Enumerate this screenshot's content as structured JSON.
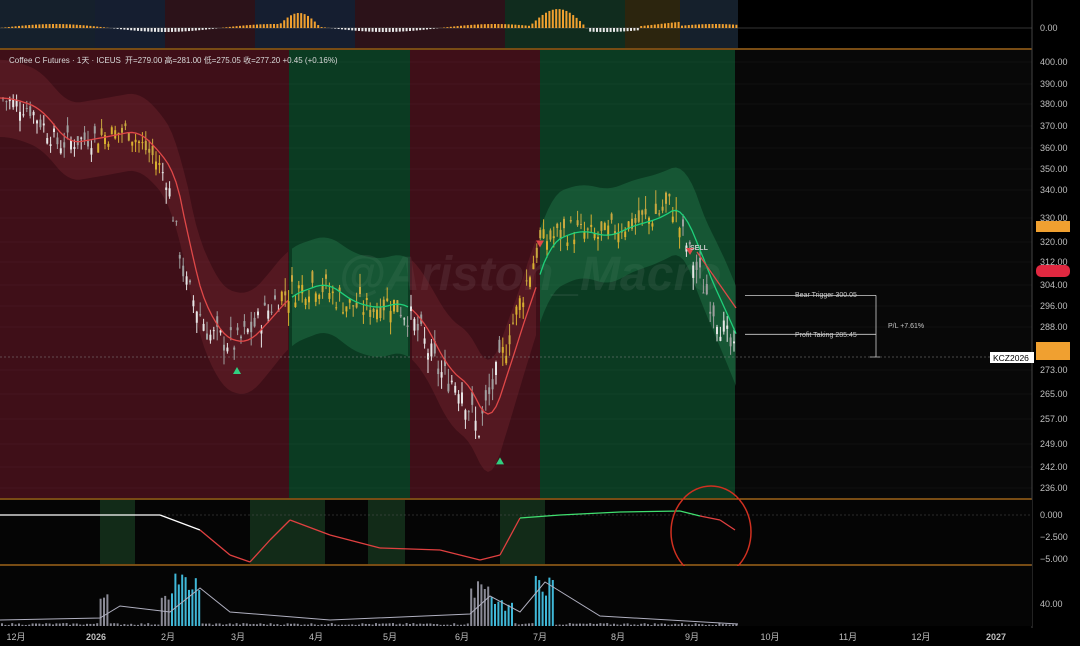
{
  "legend": {
    "symbol": "Coffee C Futures · 1天 · ICEUS",
    "ohlc": "开=279.00  高=281.00  低=275.05  收=277.20  +0.45 (+0.16%)"
  },
  "watermark": "@Ariston_Macro",
  "ticker_tag": "KCZ2026",
  "annotations": {
    "sell": "SELL",
    "bear_trigger": "Bear Trigger 300.05",
    "profit_taking": "Profit Taking 285.45",
    "pl": "P/L +7.61%"
  },
  "colors": {
    "background": "#000000",
    "bull_zone": "#0b3b22",
    "bear_zone": "#3f0f18",
    "orange_accent": "#f0a030",
    "trend_line_bull": "#1fd07a",
    "trend_line_bear": "#e04848",
    "circle": "#d03020"
  },
  "chart_data": {
    "type": "candlestick",
    "title": "Coffee C Futures · 1天 · ICEUS",
    "x_axis": {
      "ticks": [
        "12月",
        "2026",
        "2月",
        "3月",
        "4月",
        "5月",
        "6月",
        "7月",
        "8月",
        "9月",
        "10月",
        "11月",
        "12月",
        "2027"
      ]
    },
    "price_axis": {
      "ticks": [
        "400.00",
        "390.00",
        "380.00",
        "370.00",
        "360.00",
        "350.00",
        "340.00",
        "330.00",
        "320.00",
        "312.00",
        "304.00",
        "296.00",
        "288.00",
        "273.00",
        "265.00",
        "257.00",
        "249.00",
        "242.00",
        "236.00"
      ],
      "ylim": [
        236,
        400
      ]
    },
    "oscillator_axis": {
      "ticks": [
        "0.000",
        "−2.500",
        "−5.000"
      ]
    },
    "top_axis": {
      "ticks": [
        "0.00"
      ]
    },
    "volume_axis": {
      "ticks": [
        "40.00"
      ]
    },
    "regimes": [
      {
        "from": "12月",
        "to": "3月下",
        "state": "bear"
      },
      {
        "from": "3月下",
        "to": "5月中",
        "state": "bull"
      },
      {
        "from": "5月中",
        "to": "7月",
        "state": "bear"
      },
      {
        "from": "7月",
        "to": "9月中",
        "state": "bull"
      }
    ],
    "close_path": [
      {
        "x": "11月末",
        "y": 383
      },
      {
        "x": "12月中",
        "y": 378
      },
      {
        "x": "12月末",
        "y": 362
      },
      {
        "x": "2026",
        "y": 365
      },
      {
        "x": "1月中",
        "y": 368
      },
      {
        "x": "1月末",
        "y": 355
      },
      {
        "x": "2月",
        "y": 345
      },
      {
        "x": "2月中",
        "y": 305
      },
      {
        "x": "2月末",
        "y": 285
      },
      {
        "x": "3月",
        "y": 282
      },
      {
        "x": "3月中",
        "y": 290
      },
      {
        "x": "3月末",
        "y": 300
      },
      {
        "x": "4月",
        "y": 305
      },
      {
        "x": "4月中",
        "y": 297
      },
      {
        "x": "4月末",
        "y": 295
      },
      {
        "x": "5月",
        "y": 298
      },
      {
        "x": "5月中",
        "y": 292
      },
      {
        "x": "5月末",
        "y": 272
      },
      {
        "x": "6月",
        "y": 268
      },
      {
        "x": "6月中",
        "y": 253
      },
      {
        "x": "6月末",
        "y": 275
      },
      {
        "x": "7月",
        "y": 320
      },
      {
        "x": "7月中",
        "y": 325
      },
      {
        "x": "7月末",
        "y": 322
      },
      {
        "x": "8月",
        "y": 326
      },
      {
        "x": "8月中",
        "y": 330
      },
      {
        "x": "8月末",
        "y": 335
      },
      {
        "x": "9月",
        "y": 315
      },
      {
        "x": "9月中",
        "y": 277.2
      }
    ],
    "last_close": 277.2,
    "signals": [
      {
        "type": "buy",
        "x": "3月",
        "price": 273
      },
      {
        "type": "buy",
        "x": "6月末",
        "price": 244
      },
      {
        "type": "sell",
        "x": "7月",
        "price": 319
      },
      {
        "type": "sell",
        "x": "9月",
        "price": 316
      }
    ],
    "levels": [
      {
        "name": "Bear Trigger",
        "value": 300.05
      },
      {
        "name": "Profit Taking",
        "value": 285.45
      }
    ]
  }
}
